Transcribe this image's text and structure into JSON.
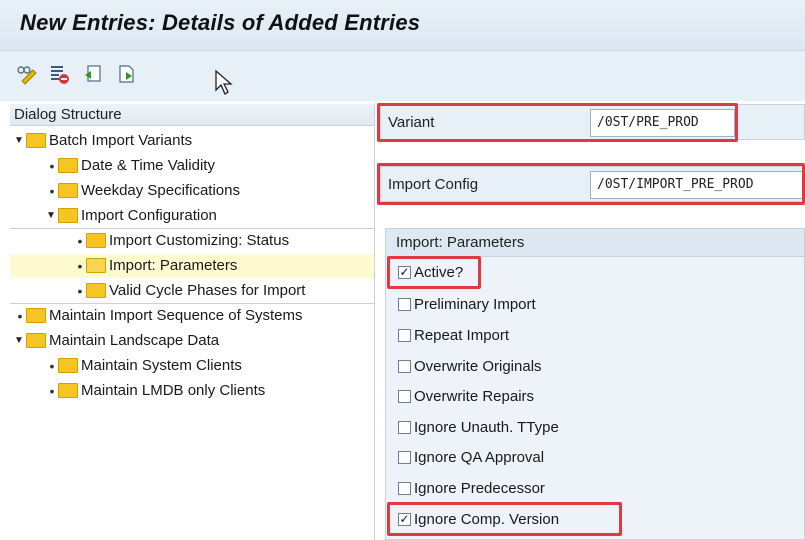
{
  "window": {
    "title": "New Entries: Details of Added Entries"
  },
  "toolbar": {
    "icons": [
      "display-change-icon",
      "delete-icon",
      "undo-icon",
      "next-entry-icon"
    ]
  },
  "dialog_structure": {
    "header": "Dialog Structure",
    "items": [
      {
        "label": "Batch Import Variants",
        "level": 0,
        "expanded": true
      },
      {
        "label": "Date & Time Validity",
        "level": 1
      },
      {
        "label": "Weekday Specifications",
        "level": 1
      },
      {
        "label": "Import Configuration",
        "level": 1,
        "expanded": true
      },
      {
        "label": "Import Customizing: Status",
        "level": 2
      },
      {
        "label": "Import: Parameters",
        "level": 2,
        "selected": true
      },
      {
        "label": "Valid Cycle Phases for Import",
        "level": 2
      },
      {
        "label": "Maintain Import Sequence of Systems",
        "level": 0
      },
      {
        "label": "Maintain Landscape Data",
        "level": 0,
        "expanded": true
      },
      {
        "label": "Maintain System Clients",
        "level": 1
      },
      {
        "label": "Maintain LMDB only Clients",
        "level": 1
      }
    ]
  },
  "fields": {
    "variant": {
      "label": "Variant",
      "value": "/0ST/PRE_PROD"
    },
    "import_config": {
      "label": "Import Config",
      "value": "/0ST/IMPORT_PRE_PROD"
    }
  },
  "parameters": {
    "header": "Import: Parameters",
    "checkboxes": [
      {
        "label": "Active?",
        "checked": true
      },
      {
        "label": "Preliminary Import",
        "checked": false
      },
      {
        "label": "Repeat Import",
        "checked": false
      },
      {
        "label": "Overwrite Originals",
        "checked": false
      },
      {
        "label": "Overwrite Repairs",
        "checked": false
      },
      {
        "label": "Ignore Unauth. TType",
        "checked": false
      },
      {
        "label": "Ignore QA Approval",
        "checked": false
      },
      {
        "label": "Ignore Predecessor",
        "checked": false
      },
      {
        "label": "Ignore Comp. Version",
        "checked": true
      }
    ]
  },
  "colors": {
    "highlight": "#e03a3f",
    "folder": "#f5c623",
    "selected_row": "#fffbd0"
  }
}
